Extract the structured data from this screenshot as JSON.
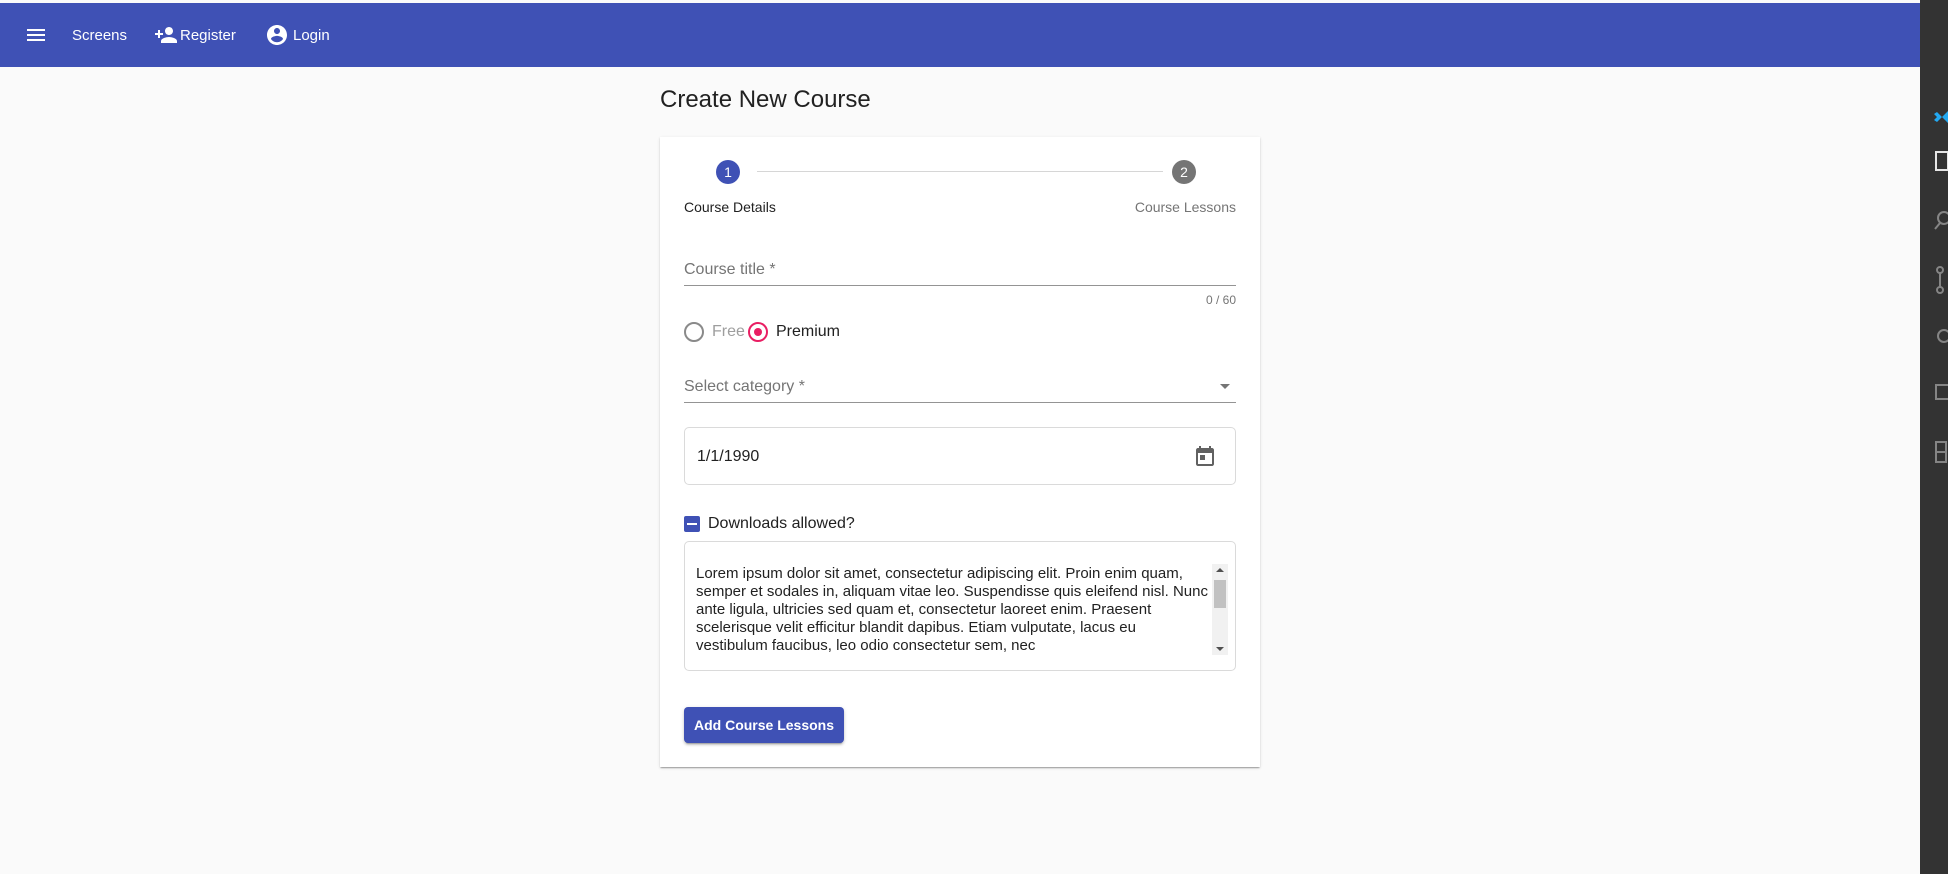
{
  "toolbar": {
    "menu_icon": "menu-icon",
    "screens_label": "Screens",
    "register_label": "Register",
    "register_icon": "person-add-icon",
    "login_label": "Login",
    "login_icon": "account-circle-icon",
    "background_color": "#3f51b5"
  },
  "page": {
    "title": "Create New Course"
  },
  "stepper": {
    "steps": [
      {
        "number": "1",
        "label": "Course Details",
        "active": true,
        "color": "#3f51b5"
      },
      {
        "number": "2",
        "label": "Course Lessons",
        "active": false,
        "color": "#757575"
      }
    ]
  },
  "form": {
    "course_title": {
      "label": "Course title *",
      "value": "",
      "counter": "0 / 60"
    },
    "price_type": {
      "options": [
        {
          "label": "Free",
          "selected": false
        },
        {
          "label": "Premium",
          "selected": true
        }
      ],
      "accent_color": "#e91e63"
    },
    "category": {
      "label": "Select category *",
      "value": "",
      "icon": "dropdown-arrow-icon"
    },
    "date": {
      "value": "1/1/1990",
      "icon": "calendar-icon"
    },
    "downloads": {
      "label": "Downloads allowed?",
      "state": "indeterminate"
    },
    "description": {
      "value": "Lorem ipsum dolor sit amet, consectetur adipiscing elit. Proin enim quam, semper et sodales in, aliquam vitae leo. Suspendisse quis eleifend nisl. Nunc ante ligula, ultricies sed quam et, consectetur laoreet enim. Praesent scelerisque velit efficitur blandit dapibus. Etiam vulputate, lacus eu vestibulum faucibus, leo odio consectetur sem, nec"
    },
    "submit_label": "Add Course Lessons"
  },
  "side_strip": {
    "background_color": "#333333",
    "icons": [
      "vscode-logo-icon",
      "explorer-icon",
      "search-icon",
      "source-control-icon",
      "debug-icon",
      "remote-explorer-icon",
      "extensions-icon"
    ]
  }
}
